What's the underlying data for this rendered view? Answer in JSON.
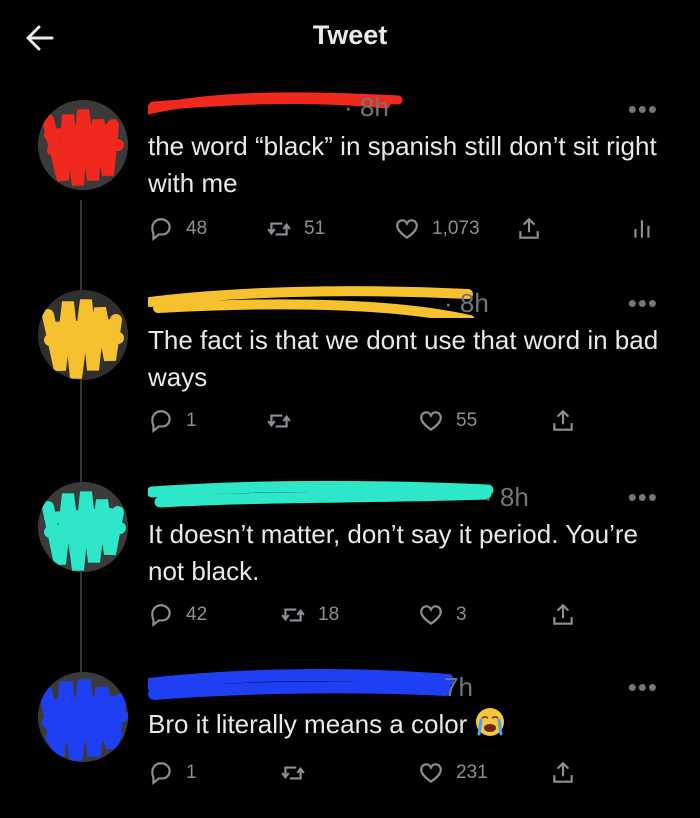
{
  "header": {
    "title": "Tweet"
  },
  "tweets": [
    {
      "time": "· 8h",
      "text": "the word “black” in spanish still don’t sit right with me",
      "replies": "48",
      "retweets": "51",
      "likes": "1,073",
      "scribble_color": "#f0281e"
    },
    {
      "time": "· 8h",
      "text": "The fact is that we dont use that word in bad ways",
      "replies": "1",
      "retweets": "",
      "likes": "55",
      "scribble_color": "#f5c12e"
    },
    {
      "time": "· 8h",
      "text": "It doesn’t matter, don’t say it period. You’re not black.",
      "replies": "42",
      "retweets": "18",
      "likes": "3",
      "scribble_color": "#2ee6c8"
    },
    {
      "time": "7h",
      "text": "Bro it literally means a color",
      "replies": "1",
      "retweets": "",
      "likes": "231",
      "scribble_color": "#1f3ff2"
    }
  ],
  "icons": [
    "back-arrow-icon",
    "more-icon",
    "reply-icon",
    "retweet-icon",
    "like-icon",
    "share-icon",
    "analytics-icon",
    "loudly-crying-emoji"
  ]
}
